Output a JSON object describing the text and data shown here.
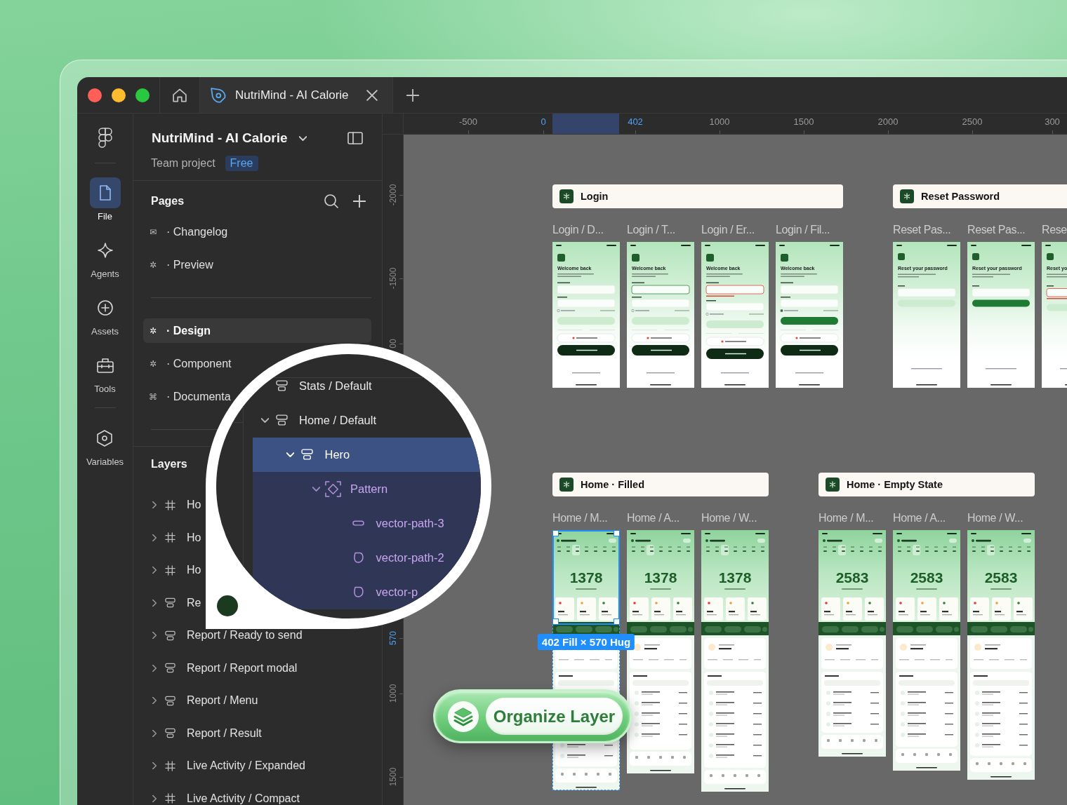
{
  "window": {
    "tabs": [
      {
        "label": "NutriMind - AI Calorie",
        "selected": true
      }
    ]
  },
  "rail": {
    "items": [
      {
        "label": "File",
        "selected": true
      },
      {
        "label": "Agents",
        "selected": false
      },
      {
        "label": "Assets",
        "selected": false
      },
      {
        "label": "Tools",
        "selected": false
      },
      {
        "label": "Variables",
        "selected": false
      }
    ]
  },
  "file": {
    "title": "NutriMind - AI Calorie",
    "subtitle": "Team project",
    "plan": "Free"
  },
  "pages": {
    "title": "Pages",
    "items": [
      {
        "kind": "page",
        "glyph": "✉",
        "label": "· Changelog",
        "selected": false
      },
      {
        "kind": "page",
        "glyph": "✲",
        "label": "· Preview",
        "selected": false
      },
      {
        "kind": "divider"
      },
      {
        "kind": "page",
        "glyph": "✲",
        "label": "· Design",
        "selected": true
      },
      {
        "kind": "page",
        "glyph": "✲",
        "label": "· Component",
        "selected": false
      },
      {
        "kind": "page",
        "glyph": "⌘",
        "label": "· Documenta",
        "selected": false
      },
      {
        "kind": "divider"
      }
    ]
  },
  "layers": {
    "title": "Layers",
    "items": [
      {
        "kind": "frame",
        "label": "Ho",
        "expanded": false
      },
      {
        "kind": "frame",
        "label": "Ho",
        "expanded": false
      },
      {
        "kind": "frame",
        "label": "Ho",
        "expanded": false
      },
      {
        "kind": "stack",
        "label": "Re",
        "expanded": false
      },
      {
        "kind": "stack",
        "label": "Report / Ready to send",
        "expanded": false
      },
      {
        "kind": "stack",
        "label": "Report / Report modal",
        "expanded": false
      },
      {
        "kind": "stack",
        "label": "Report / Menu",
        "expanded": false
      },
      {
        "kind": "stack",
        "label": "Report / Result",
        "expanded": false
      },
      {
        "kind": "frame",
        "label": "Live Activity / Expanded",
        "expanded": false
      },
      {
        "kind": "frame",
        "label": "Live Activity / Compact",
        "expanded": false
      }
    ]
  },
  "magnifier": {
    "rows": [
      {
        "kind": "stack",
        "label": "Stats / Default",
        "selected": false
      },
      {
        "kind": "stack",
        "label": "Home / Default",
        "expanded": true,
        "selected": false,
        "children": [
          {
            "kind": "stack",
            "label": "Hero",
            "expanded": true,
            "selected": true,
            "children": [
              {
                "kind": "pattern",
                "label": "Pattern",
                "expanded": true,
                "selected": false,
                "children": [
                  {
                    "kind": "vector",
                    "label": "vector-path-3",
                    "selected": false
                  },
                  {
                    "kind": "vector",
                    "label": "vector-path-2",
                    "selected": false
                  },
                  {
                    "kind": "vector",
                    "label": "vector-p",
                    "selected": false
                  }
                ]
              }
            ]
          }
        ]
      }
    ]
  },
  "canvas": {
    "ruler_top": [
      {
        "label": "-500",
        "selected": false
      },
      {
        "label": "0",
        "selected": true
      },
      {
        "label": "402",
        "selected": true
      },
      {
        "label": "1000",
        "selected": false
      },
      {
        "label": "1500",
        "selected": false
      },
      {
        "label": "2000",
        "selected": false
      },
      {
        "label": "2500",
        "selected": false
      },
      {
        "label": "300",
        "selected": false
      }
    ],
    "ruler_side": [
      {
        "label": "-2000",
        "selected": false
      },
      {
        "label": "-1500",
        "selected": false
      },
      {
        "label": "00",
        "selected": false
      },
      {
        "label": "570",
        "selected": true
      },
      {
        "label": "1000",
        "selected": false
      },
      {
        "label": "1500",
        "selected": false
      }
    ],
    "sections": [
      {
        "title": "Login",
        "frames": [
          {
            "kind": "login",
            "label": "Login / D...",
            "heading": "Welcome back",
            "selected": false
          },
          {
            "kind": "login",
            "label": "Login / T...",
            "heading": "Welcome back",
            "selected": false
          },
          {
            "kind": "login",
            "label": "Login / Er...",
            "heading": "Welcome back",
            "selected": false
          },
          {
            "kind": "login",
            "label": "Login / Fil...",
            "heading": "Welcome back",
            "selected": false
          }
        ]
      },
      {
        "title": "Reset Password",
        "frames": [
          {
            "kind": "reset",
            "label": "Reset Pas...",
            "heading": "Reset your password",
            "selected": false
          },
          {
            "kind": "reset",
            "label": "Reset Pas...",
            "heading": "Reset your password",
            "selected": false
          },
          {
            "kind": "reset",
            "label": "Rese",
            "heading": "Reset yo",
            "selected": false
          }
        ]
      },
      {
        "title": "Home · Filled",
        "frames": [
          {
            "kind": "home",
            "label": "Home / M...",
            "value": "1378",
            "selected": true
          },
          {
            "kind": "home",
            "label": "Home / A...",
            "value": "1378",
            "selected": false
          },
          {
            "kind": "home",
            "label": "Home / W...",
            "value": "1378",
            "selected": false
          }
        ]
      },
      {
        "title": "Home · Empty State",
        "frames": [
          {
            "kind": "home",
            "label": "Home / M...",
            "value": "2583",
            "selected": false
          },
          {
            "kind": "home",
            "label": "Home / A...",
            "value": "2583",
            "selected": false
          },
          {
            "kind": "home",
            "label": "Home / W...",
            "value": "2583",
            "selected": false
          }
        ]
      }
    ],
    "selection_badge": "402 Fill × 570 Hug",
    "organize_button": "Organize Layer"
  }
}
